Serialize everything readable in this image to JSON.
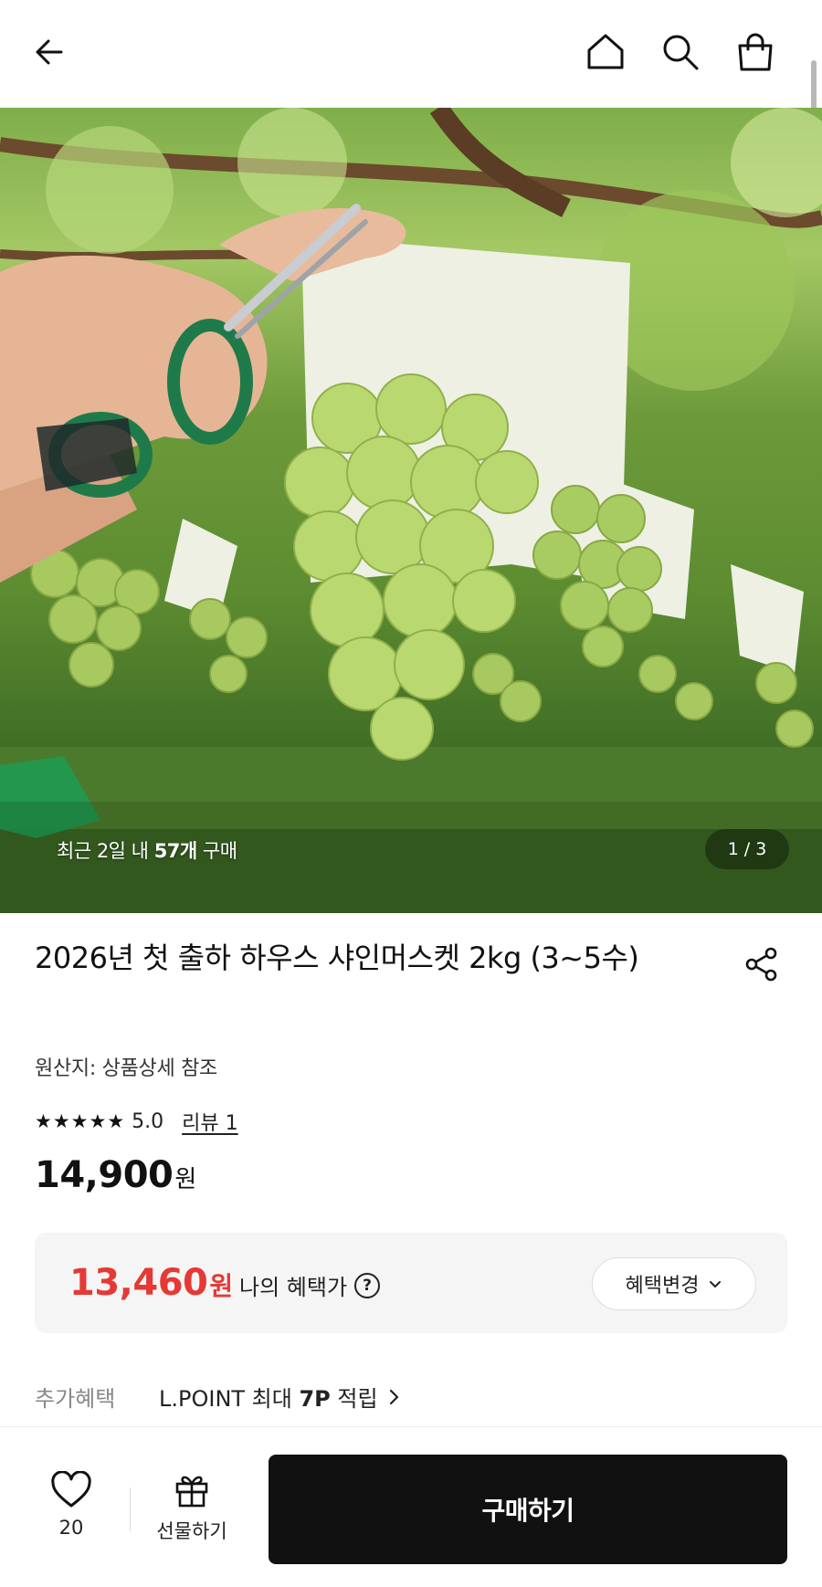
{
  "header": {
    "icons": [
      "back-arrow-icon",
      "home-icon",
      "search-icon",
      "shopping-bag-icon"
    ]
  },
  "hero": {
    "recent_prefix": "최근 2일 내",
    "recent_count": "57개",
    "recent_suffix": "구매",
    "pager_current": "1",
    "pager_sep": "/",
    "pager_total": "3"
  },
  "product": {
    "title": "2026년 첫 출하 하우스 샤인머스켓 2kg (3~5수)",
    "origin": "원산지: 상품상세 참조",
    "stars": 5,
    "rating": "5.0",
    "review_link": "리뷰 1",
    "price_value": "14,900",
    "price_unit": "원"
  },
  "benefit": {
    "price_value": "13,460",
    "price_unit": "원",
    "label": "나의 혜택가",
    "help_glyph": "?",
    "change_button": "혜택변경"
  },
  "extra": {
    "label": "추가혜택",
    "value_prefix": "L.POINT 최대",
    "value_bold": "7P",
    "value_suffix": "적립"
  },
  "bottom_bar": {
    "like_count": "20",
    "gift_label": "선물하기",
    "buy_label": "구매하기"
  },
  "colors": {
    "accent_price": "#e53935",
    "buy_button": "#111111"
  }
}
